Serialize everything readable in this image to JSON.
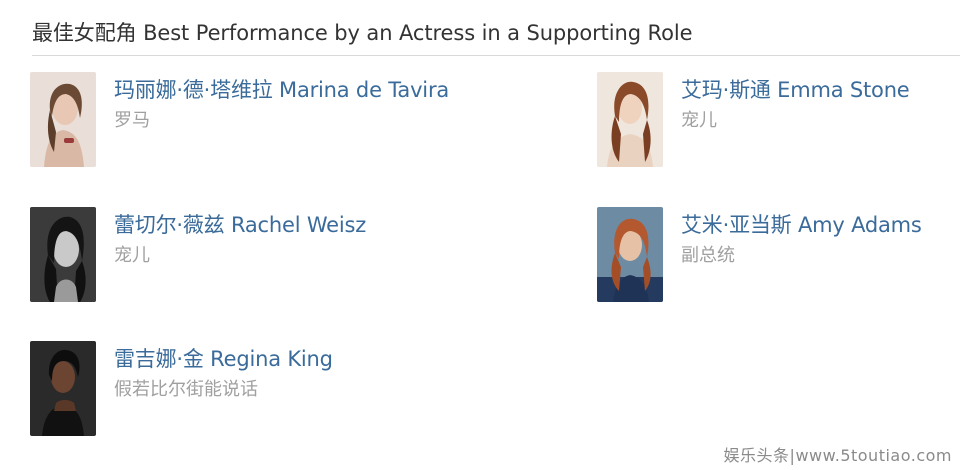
{
  "header": {
    "title": "最佳女配角 Best Performance by an Actress in a Supporting Role"
  },
  "nominees": [
    {
      "name": "玛丽娜·德·塔维拉 Marina de Tavira",
      "film": "罗马",
      "photo_icon": "actress-portrait-icon"
    },
    {
      "name": "艾玛·斯通 Emma Stone",
      "film": "宠儿",
      "photo_icon": "actress-portrait-icon"
    },
    {
      "name": "蕾切尔·薇兹 Rachel Weisz",
      "film": "宠儿",
      "photo_icon": "actress-portrait-icon"
    },
    {
      "name": "艾米·亚当斯 Amy Adams",
      "film": "副总统",
      "photo_icon": "actress-portrait-icon"
    },
    {
      "name": "雷吉娜·金 Regina King",
      "film": "假若比尔街能说话",
      "photo_icon": "actress-portrait-icon"
    }
  ],
  "watermark": {
    "text": "娱乐头条|www.5toutiao.com"
  },
  "colors": {
    "link": "#3a6b9a",
    "muted": "#a0a0a0",
    "title": "#333333",
    "divider": "#d9d9d9"
  }
}
